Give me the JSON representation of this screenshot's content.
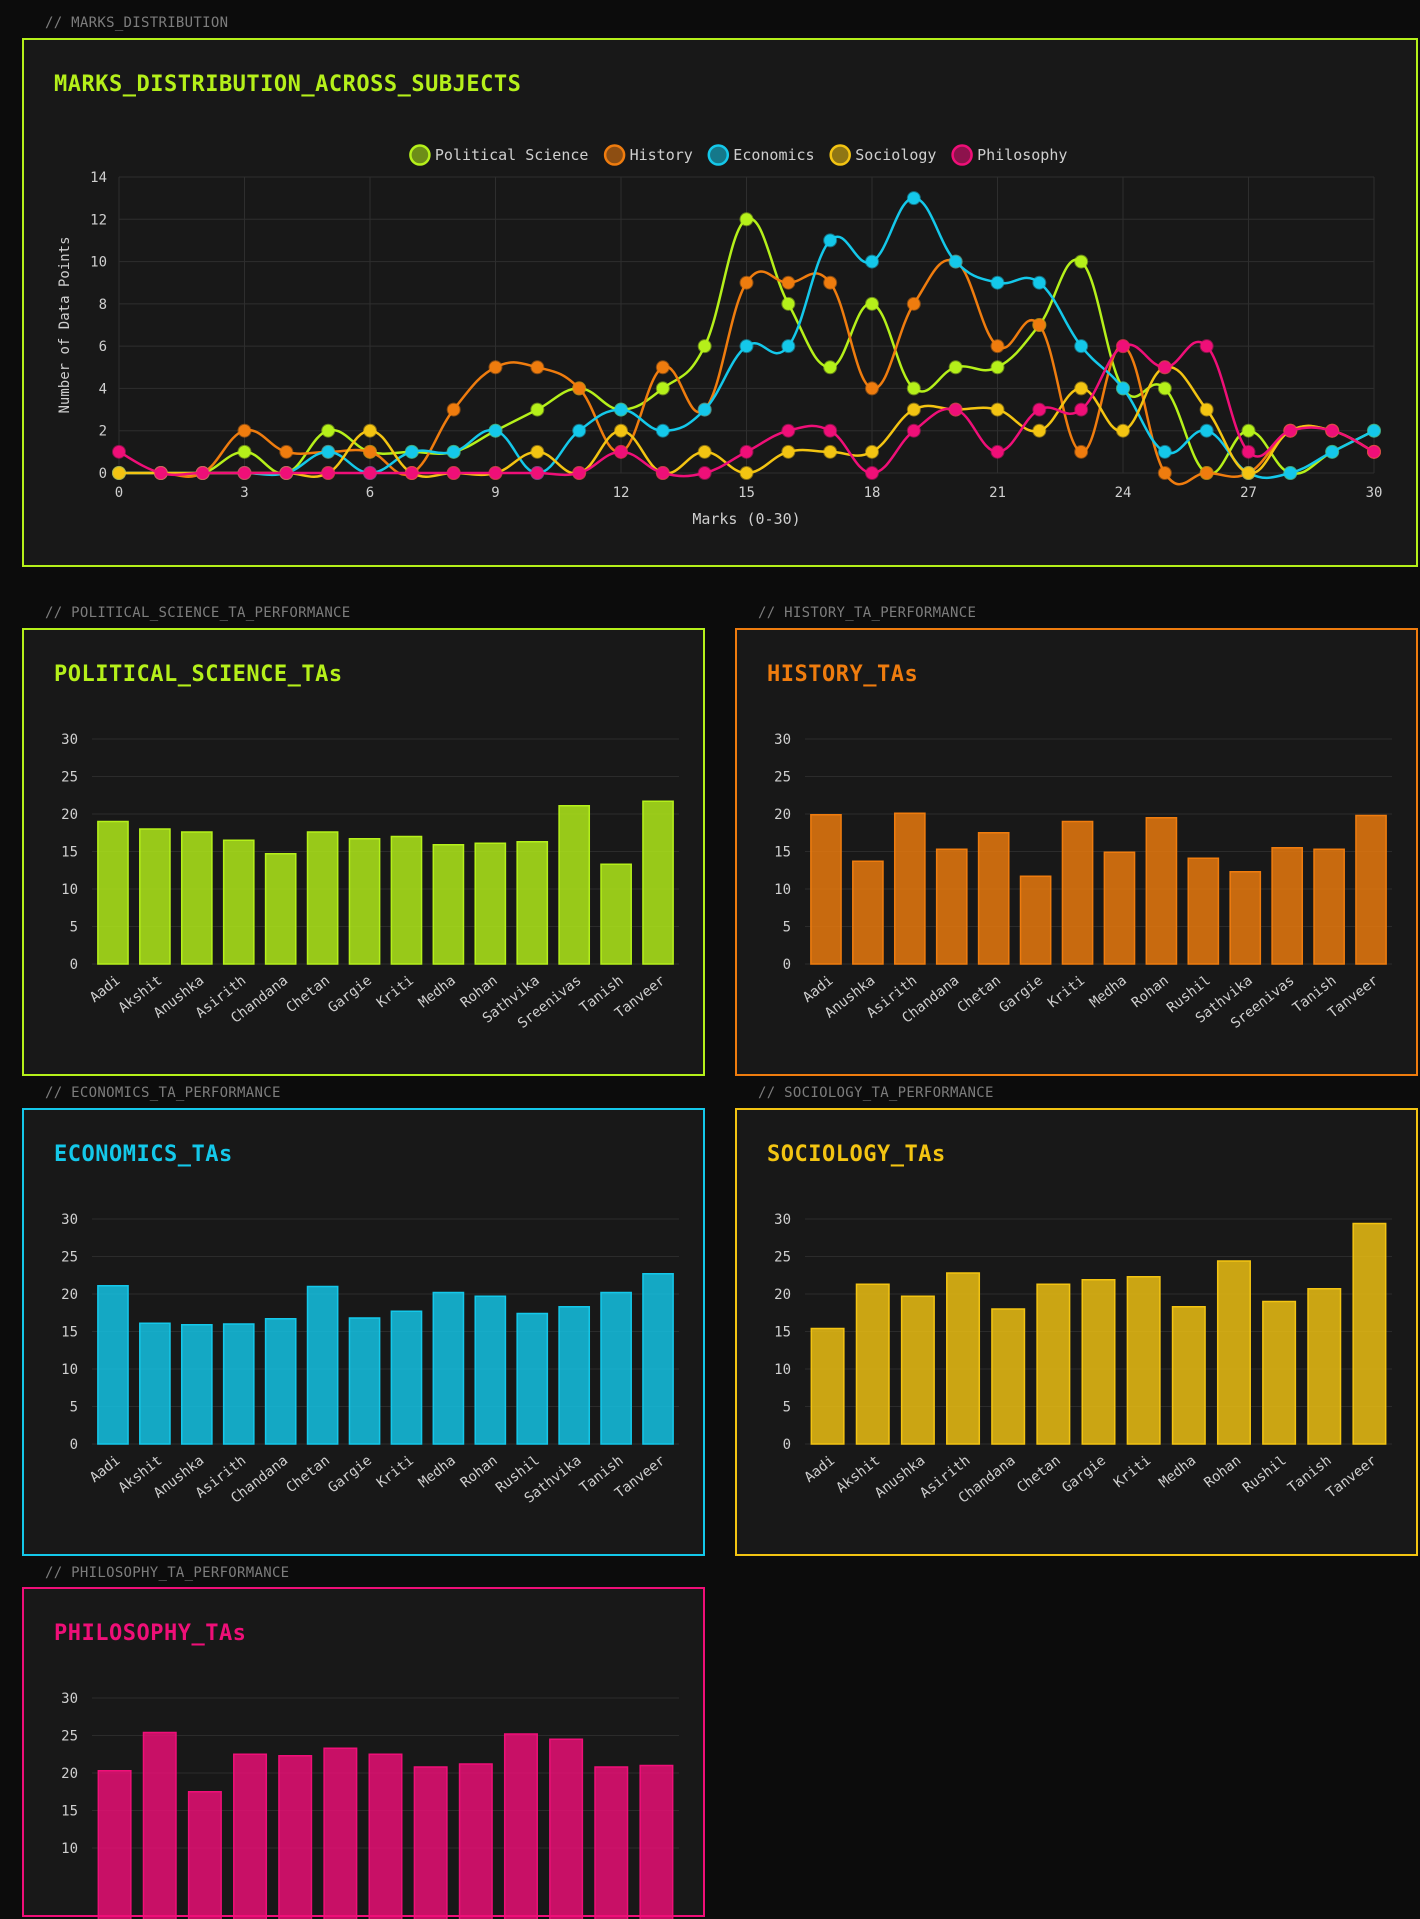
{
  "colors": {
    "political_science": "#b5f01a",
    "history": "#ef7c0e",
    "economics": "#14c8ea",
    "sociology": "#f3c412",
    "philosophy": "#ef0f78"
  },
  "marks_distribution": {
    "section_label": "// MARKS_DISTRIBUTION",
    "title": "MARKS_DISTRIBUTION_ACROSS_SUBJECTS"
  },
  "political_science": {
    "section_label": "// POLITICAL_SCIENCE_TA_PERFORMANCE",
    "title": "POLITICAL_SCIENCE_TAs"
  },
  "history": {
    "section_label": "// HISTORY_TA_PERFORMANCE",
    "title": "HISTORY_TAs"
  },
  "economics": {
    "section_label": "// ECONOMICS_TA_PERFORMANCE",
    "title": "ECONOMICS_TAs"
  },
  "sociology": {
    "section_label": "// SOCIOLOGY_TA_PERFORMANCE",
    "title": "SOCIOLOGY_TAs"
  },
  "philosophy": {
    "section_label": "// PHILOSOPHY_TA_PERFORMANCE",
    "title": "PHILOSOPHY_TAs"
  },
  "chart_data": [
    {
      "type": "line",
      "title": "MARKS_DISTRIBUTION_ACROSS_SUBJECTS",
      "xlabel": "Marks (0-30)",
      "ylabel": "Number of Data Points",
      "xlim": [
        0,
        30
      ],
      "ylim": [
        0,
        14
      ],
      "x_ticks": [
        0,
        3,
        6,
        9,
        12,
        15,
        18,
        21,
        24,
        27,
        30
      ],
      "y_ticks": [
        0,
        2,
        4,
        6,
        8,
        10,
        12,
        14
      ],
      "grid": true,
      "legend": "top-center",
      "x": [
        0,
        1,
        2,
        3,
        4,
        5,
        6,
        7,
        8,
        9,
        10,
        11,
        12,
        13,
        14,
        15,
        16,
        17,
        18,
        19,
        20,
        21,
        22,
        23,
        24,
        25,
        26,
        27,
        28,
        29,
        30
      ],
      "series": [
        {
          "name": "Political Science",
          "color": "#b5f01a",
          "values": [
            0,
            0,
            0,
            1,
            0,
            2,
            1,
            1,
            1,
            2,
            3,
            4,
            3,
            4,
            6,
            12,
            8,
            5,
            8,
            4,
            5,
            5,
            7,
            10,
            4,
            4,
            0,
            2,
            0,
            1,
            2
          ]
        },
        {
          "name": "History",
          "color": "#ef7c0e",
          "values": [
            0,
            0,
            0,
            2,
            1,
            1,
            1,
            0,
            3,
            5,
            5,
            4,
            1,
            5,
            3,
            9,
            9,
            9,
            4,
            8,
            10,
            6,
            7,
            1,
            6,
            0,
            0,
            0,
            2,
            2,
            1
          ]
        },
        {
          "name": "Economics",
          "color": "#14c8ea",
          "values": [
            0,
            0,
            0,
            0,
            0,
            1,
            0,
            1,
            1,
            2,
            0,
            2,
            3,
            2,
            3,
            6,
            6,
            11,
            10,
            13,
            10,
            9,
            9,
            6,
            4,
            1,
            2,
            0,
            0,
            1,
            2
          ]
        },
        {
          "name": "Sociology",
          "color": "#f3c412",
          "values": [
            0,
            0,
            0,
            0,
            0,
            0,
            2,
            0,
            0,
            0,
            1,
            0,
            2,
            0,
            1,
            0,
            1,
            1,
            1,
            3,
            3,
            3,
            2,
            4,
            2,
            5,
            3,
            0,
            2,
            2,
            1
          ]
        },
        {
          "name": "Philosophy",
          "color": "#ef0f78",
          "values": [
            1,
            0,
            0,
            0,
            0,
            0,
            0,
            0,
            0,
            0,
            0,
            0,
            1,
            0,
            0,
            1,
            2,
            2,
            0,
            2,
            3,
            1,
            3,
            3,
            6,
            5,
            6,
            1,
            2,
            2,
            1
          ]
        }
      ]
    },
    {
      "type": "bar",
      "title": "POLITICAL_SCIENCE_TAs",
      "ylim": [
        0,
        30
      ],
      "y_ticks": [
        0,
        5,
        10,
        15,
        20,
        25,
        30
      ],
      "categories": [
        "Aadi",
        "Akshit",
        "Anushka",
        "Asirith",
        "Chandana",
        "Chetan",
        "Gargie",
        "Kriti",
        "Medha",
        "Rohan",
        "Sathvika",
        "Sreenivas",
        "Tanish",
        "Tanveer"
      ],
      "values": [
        19.0,
        18.0,
        17.6,
        16.5,
        14.7,
        17.6,
        16.7,
        17.0,
        15.9,
        16.1,
        16.3,
        21.1,
        13.3,
        21.7
      ]
    },
    {
      "type": "bar",
      "title": "HISTORY_TAs",
      "ylim": [
        0,
        30
      ],
      "y_ticks": [
        0,
        5,
        10,
        15,
        20,
        25,
        30
      ],
      "categories": [
        "Aadi",
        "Anushka",
        "Asirith",
        "Chandana",
        "Chetan",
        "Gargie",
        "Kriti",
        "Medha",
        "Rohan",
        "Rushil",
        "Sathvika",
        "Sreenivas",
        "Tanish",
        "Tanveer"
      ],
      "values": [
        19.9,
        13.7,
        20.1,
        15.3,
        17.5,
        11.7,
        19.0,
        14.9,
        19.5,
        14.1,
        12.3,
        15.5,
        15.3,
        19.8
      ]
    },
    {
      "type": "bar",
      "title": "ECONOMICS_TAs",
      "ylim": [
        0,
        30
      ],
      "y_ticks": [
        0,
        5,
        10,
        15,
        20,
        25,
        30
      ],
      "categories": [
        "Aadi",
        "Akshit",
        "Anushka",
        "Asirith",
        "Chandana",
        "Chetan",
        "Gargie",
        "Kriti",
        "Medha",
        "Rohan",
        "Rushil",
        "Sathvika",
        "Tanish",
        "Tanveer"
      ],
      "values": [
        21.1,
        16.1,
        15.9,
        16.0,
        16.7,
        21.0,
        16.8,
        17.7,
        20.2,
        19.7,
        17.4,
        18.3,
        20.2,
        22.7
      ]
    },
    {
      "type": "bar",
      "title": "SOCIOLOGY_TAs",
      "ylim": [
        0,
        30
      ],
      "y_ticks": [
        0,
        5,
        10,
        15,
        20,
        25,
        30
      ],
      "categories": [
        "Aadi",
        "Akshit",
        "Anushka",
        "Asirith",
        "Chandana",
        "Chetan",
        "Gargie",
        "Kriti",
        "Medha",
        "Rohan",
        "Rushil",
        "Tanish",
        "Tanveer"
      ],
      "values": [
        15.4,
        21.3,
        19.7,
        22.8,
        18.0,
        21.3,
        21.9,
        22.3,
        18.3,
        24.4,
        19.0,
        20.7,
        29.4
      ]
    },
    {
      "type": "bar",
      "title": "PHILOSOPHY_TAs",
      "ylim": [
        0,
        30
      ],
      "y_ticks": [
        10,
        15,
        20,
        25,
        30
      ],
      "categories": [
        "",
        "",
        "",
        "",
        "",
        "",
        "",
        "",
        "",
        "",
        "",
        "",
        ""
      ],
      "values": [
        20.3,
        25.4,
        17.5,
        22.5,
        22.3,
        23.3,
        22.5,
        20.8,
        21.2,
        25.2,
        24.5,
        20.8,
        21.0
      ]
    }
  ]
}
